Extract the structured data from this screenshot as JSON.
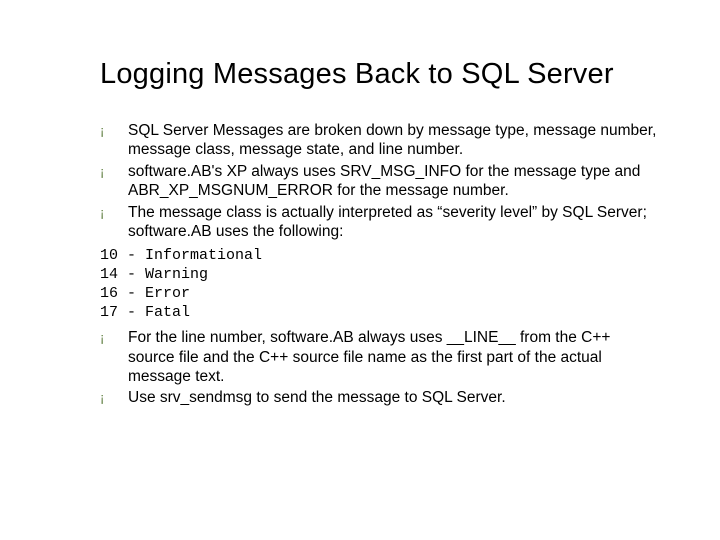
{
  "title": "Logging Messages Back to SQL Server",
  "bullets_top": [
    "SQL Server Messages are broken down by message type, message number, message class, message state, and line number.",
    "software.AB's XP always uses SRV_MSG_INFO for the message type and ABR_XP_MSGNUM_ERROR for the message number.",
    "The message class is actually interpreted as “severity level” by SQL Server; software.AB uses the following:"
  ],
  "code_lines": [
    "10 - Informational",
    "14 - Warning",
    "16 - Error",
    "17 - Fatal"
  ],
  "bullets_bottom": [
    "For the line number, software.AB always uses __LINE__ from the C++ source file and the C++ source file name as the first part of the actual message text.",
    "Use srv_sendmsg to send the message to SQL Server."
  ],
  "bullet_glyph": "¡"
}
